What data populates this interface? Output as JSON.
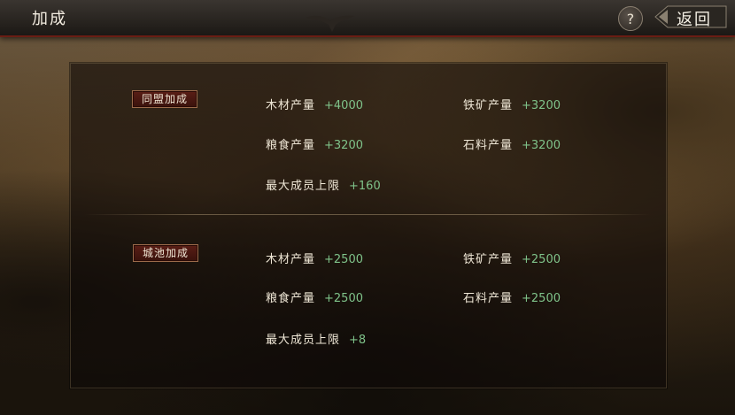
{
  "header": {
    "title": "加成",
    "help_label": "?",
    "back_label": "返回"
  },
  "alliance": {
    "tag": "同盟加成",
    "stats": [
      {
        "label": "木材产量",
        "value": "+4000"
      },
      {
        "label": "铁矿产量",
        "value": "+3200"
      },
      {
        "label": "粮食产量",
        "value": "+3200"
      },
      {
        "label": "石料产量",
        "value": "+3200"
      },
      {
        "label": "最大成员上限",
        "value": "+160"
      }
    ]
  },
  "city": {
    "tag": "城池加成",
    "stats": [
      {
        "label": "木材产量",
        "value": "+2500"
      },
      {
        "label": "铁矿产量",
        "value": "+2500"
      },
      {
        "label": "粮食产量",
        "value": "+2500"
      },
      {
        "label": "石料产量",
        "value": "+2500"
      },
      {
        "label": "最大成员上限",
        "value": "+8"
      }
    ]
  },
  "colors": {
    "value_green": "#7fc38a",
    "tag_red": "#5a1e16",
    "accent_red": "#6a1d14"
  }
}
